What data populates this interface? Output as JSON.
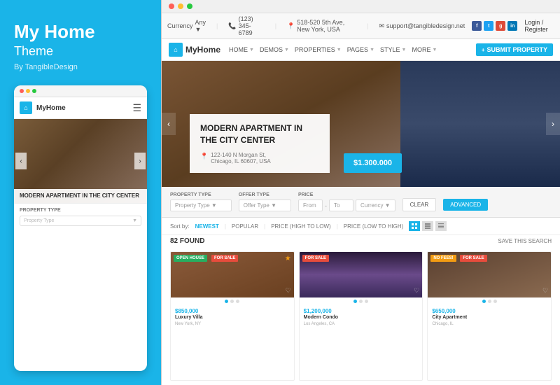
{
  "left": {
    "title": "My Home",
    "subtitle": "Theme",
    "by": "By TangibleDesign",
    "mobile_brand": "MyHome",
    "mobile_dots": [
      "red",
      "yellow",
      "green"
    ],
    "mobile_caption": "MODERN APARTMENT IN THE CITY CENTER",
    "mobile_prop_label": "PROPERTY TYPE",
    "mobile_prop_placeholder": "Property Type"
  },
  "browser": {
    "phone": "(123) 345-6789",
    "address": "518-520 5th Ave, New York, USA",
    "email": "support@tangibledesign.net",
    "login": "Login / Register"
  },
  "nav": {
    "logo": "MyHome",
    "items": [
      "HOME",
      "DEMOS",
      "PROPERTIES",
      "PAGES",
      "STYLE",
      "MORE"
    ],
    "submit": "SUBMIT PROPERTY"
  },
  "hero": {
    "title": "MODERN APARTMENT IN THE CITY CENTER",
    "address_line1": "122-140 N Morgan St,",
    "address_line2": "Chicago, IL 60607, USA",
    "price": "$1.300.000"
  },
  "search": {
    "prop_type_label": "PROPERTY TYPE",
    "prop_type_placeholder": "Property Type",
    "offer_type_label": "OFFER TYPE",
    "offer_type_placeholder": "Offer Type",
    "price_label": "PRICE",
    "price_from": "From",
    "price_to": "To",
    "currency_label": "Currency",
    "clear_btn": "CLEAR",
    "advanced_btn": "ADVANCED"
  },
  "results": {
    "sort_label": "Sort by:",
    "sort_options": [
      "NEWEST",
      "POPULAR",
      "PRICE (HIGH TO LOW)",
      "PRICE (LOW TO HIGH)"
    ],
    "active_sort": 0,
    "count": "82 FOUND",
    "save_search": "SAVE THIS SEARCH"
  },
  "properties": [
    {
      "badge1": "OPEN HOUSE",
      "badge2": "FOR SALE",
      "title": "Luxury Villa",
      "price": "$850,000",
      "address": "New York, NY"
    },
    {
      "badge1": "FOR SALE",
      "title": "Modern Condo",
      "price": "$1,200,000",
      "address": "Los Angeles, CA"
    },
    {
      "badge1": "NO FEES!",
      "badge2": "FOR SALE",
      "title": "City Apartment",
      "price": "$650,000",
      "address": "Chicago, IL"
    }
  ]
}
